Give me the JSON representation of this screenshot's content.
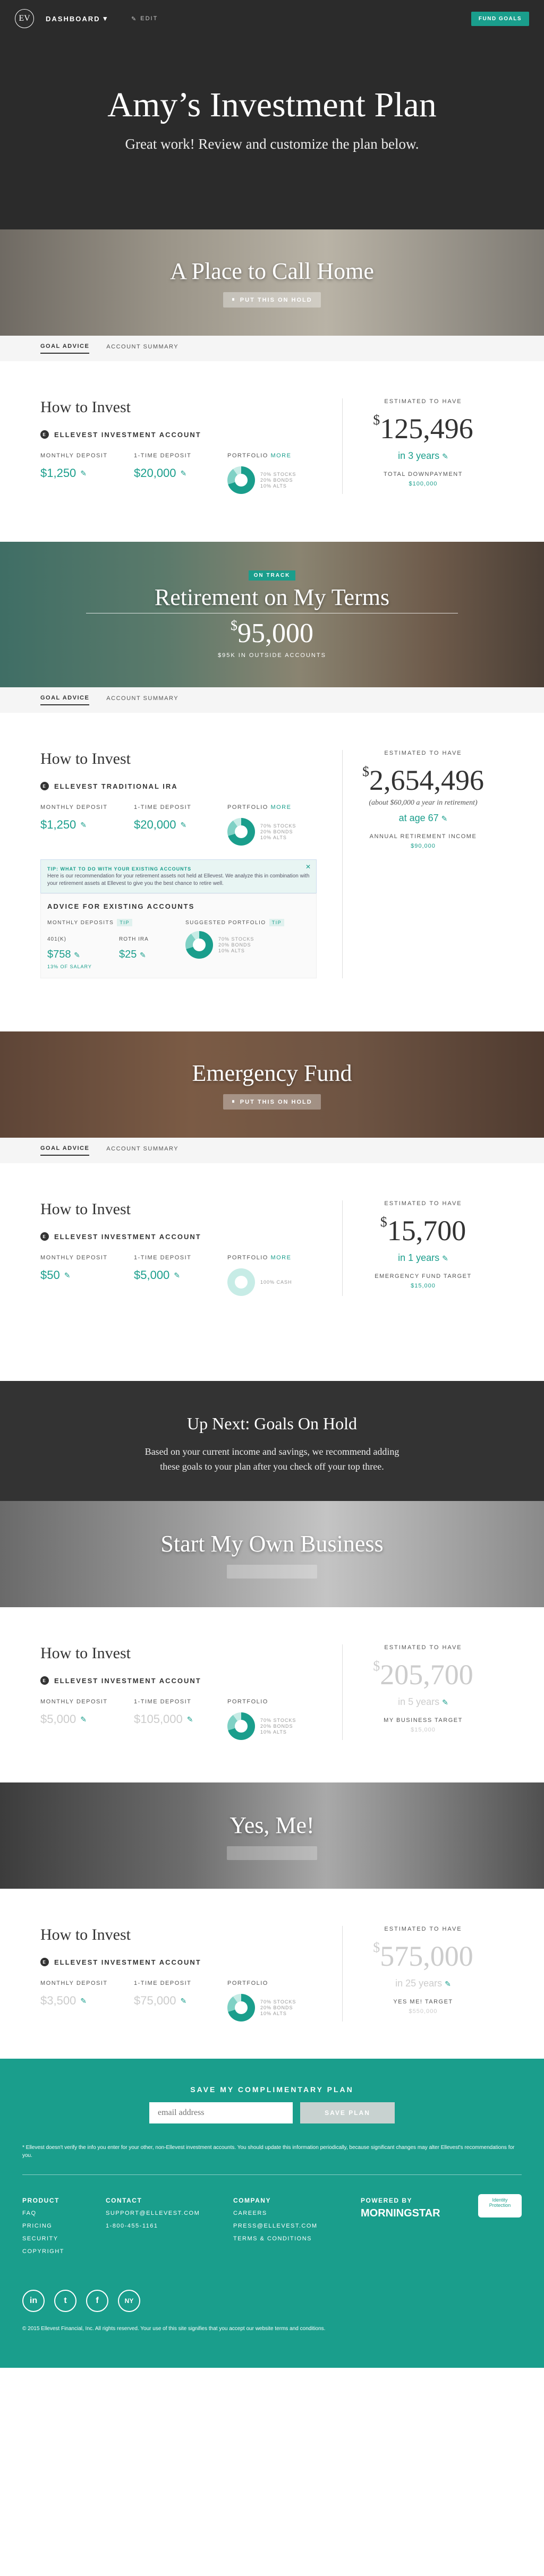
{
  "nav": {
    "dashboard": "DASHBOARD",
    "edit": "EDIT",
    "fund_goals": "FUND GOALS",
    "logo": "EV"
  },
  "hero": {
    "title": "Amy’s Investment Plan",
    "subtitle": "Great work! Review and customize the plan below."
  },
  "tabs": {
    "goal_advice": "GOAL ADVICE",
    "account_summary": "ACCOUNT SUMMARY"
  },
  "common": {
    "how_to_invest": "How to Invest",
    "monthly_deposit": "MONTHLY DEPOSIT",
    "one_time_deposit": "1-TIME DEPOSIT",
    "portfolio": "PORTFOLIO",
    "more": "MORE",
    "estimated": "ESTIMATED TO HAVE"
  },
  "goal1": {
    "banner": "A Place to Call Home",
    "pill": "PUT THIS ON HOLD",
    "account": "ELLEVEST INVESTMENT ACCOUNT",
    "monthly": "$1,250",
    "one_time": "$20,000",
    "portfolio": [
      "70% STOCKS",
      "20% BONDS",
      "10% ALTS"
    ],
    "amount": "125,496",
    "time": "in 3 years",
    "target_label": "TOTAL DOWNPAYMENT",
    "target": "$100,000"
  },
  "goal2": {
    "banner": "Retirement on My Terms",
    "badge": "ON TRACK",
    "banner_amount": "95,000",
    "banner_sub": "$95K IN OUTSIDE ACCOUNTS",
    "account": "ELLEVEST TRADITIONAL IRA",
    "monthly": "$1,250",
    "one_time": "$20,000",
    "portfolio": [
      "70% STOCKS",
      "20% BONDS",
      "10% ALTS"
    ],
    "amount": "2,654,496",
    "note": "(about $60,000 a year in retirement)",
    "time": "at age 67",
    "target_label": "ANNUAL RETIREMENT INCOME",
    "target": "$90,000",
    "tip_title": "TIP: WHAT TO DO WITH YOUR EXISTING ACCOUNTS",
    "tip_text": "Here is our recommendation for your retirement assets not held at Ellevest. We analyze this in combination with your retirement assets at Ellevest to give you the best chance to retire well.",
    "advice_title": "ADVICE FOR EXISTING ACCOUNTS",
    "monthly_deposits": "MONTHLY DEPOSITS",
    "suggested": "SUGGESTED PORTFOLIO",
    "tip_tag": "TIP",
    "k401_label": "401(K)",
    "k401": "$758",
    "k401_note": "13% OF SALARY",
    "roth_label": "ROTH IRA",
    "roth": "$25",
    "advice_portfolio": [
      "70% STOCKS",
      "20% BONDS",
      "10% ALTS"
    ]
  },
  "goal3": {
    "banner": "Emergency Fund",
    "pill": "PUT THIS ON HOLD",
    "account": "ELLEVEST INVESTMENT ACCOUNT",
    "monthly": "$50",
    "one_time": "$5,000",
    "portfolio": [
      "100% CASH"
    ],
    "amount": "15,700",
    "time": "in 1 years",
    "target_label": "EMERGENCY FUND TARGET",
    "target": "$15,000"
  },
  "upnext": {
    "title": "Up Next: Goals On Hold",
    "text1": "Based on your current income and savings, we recommend adding",
    "text2": "these goals to your plan after you check off your top three."
  },
  "goal4": {
    "banner": "Start My Own Business",
    "account": "ELLEVEST INVESTMENT ACCOUNT",
    "monthly": "$5,000",
    "one_time": "$105,000",
    "portfolio": [
      "70% STOCKS",
      "20% BONDS",
      "10% ALTS"
    ],
    "amount": "205,700",
    "time": "in 5 years",
    "target_label": "MY BUSINESS TARGET",
    "target": "$15,000"
  },
  "goal5": {
    "banner": "Yes, Me!",
    "account": "ELLEVEST INVESTMENT ACCOUNT",
    "monthly": "$3,500",
    "one_time": "$75,000",
    "portfolio": [
      "70% STOCKS",
      "20% BONDS",
      "10% ALTS"
    ],
    "amount": "575,000",
    "time": "in 25 years",
    "target_label": "YES ME! TARGET",
    "target": "$550,000"
  },
  "footer": {
    "save": "SAVE MY COMPLIMENTARY PLAN",
    "email_placeholder": "email address",
    "save_btn": "SAVE PLAN",
    "disclaimer": "* Ellevest doesn't verify the info you enter for your other, non-Ellevest investment accounts. You should update this information periodically, because significant changes may alter Ellevest's recommendations for you.",
    "product": "PRODUCT",
    "faq": "FAQ",
    "pricing": "PRICING",
    "security": "SECURITY",
    "copyright": "COPYRIGHT",
    "contact": "CONTACT",
    "email": "SUPPORT@ELLEVEST.COM",
    "phone": "1-800-455-1161",
    "company": "COMPANY",
    "careers": "CAREERS",
    "press": "PRESS@ELLEVEST.COM",
    "terms": "TERMS & CONDITIONS",
    "powered": "POWERED BY",
    "morningstar": "MORNINGSTAR",
    "badge": "Identity Protection",
    "copy": "© 2015 Ellevest Financial, Inc. All rights reserved. Your use of this site signifies that you accept our website terms and conditions."
  },
  "colors": {
    "accent": "#1a9e8c",
    "dark": "#2b2b2b"
  }
}
